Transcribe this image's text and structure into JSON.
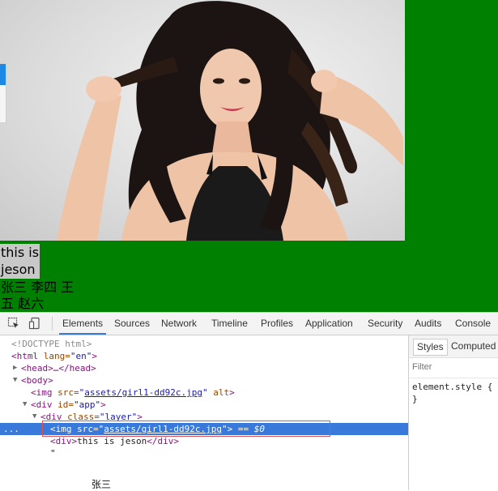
{
  "page": {
    "photo_alt": "woman with long dark hair",
    "caption_line1": "this is",
    "caption_line2": "jeson",
    "names_line1": "张三 李四 王",
    "names_line2": "五 赵六"
  },
  "devtools": {
    "tools": [
      "inspect-icon",
      "device-mode-icon"
    ],
    "tabs": [
      {
        "label": "Elements",
        "active": true
      },
      {
        "label": "Sources"
      },
      {
        "label": "Network"
      },
      {
        "label": "Timeline"
      },
      {
        "label": "Profiles"
      },
      {
        "label": "Application"
      },
      {
        "label": "Security"
      },
      {
        "label": "Audits"
      },
      {
        "label": "Console"
      }
    ],
    "dom": {
      "doctype": "<!DOCTYPE html>",
      "html_open_tag": "<html",
      "html_lang_attr": " lang=",
      "html_lang_val": "\"en\"",
      "html_close": ">",
      "head": "<head>…</head>",
      "body": "<body>",
      "img1_open": "<img",
      "img1_src_attr": " src=",
      "img1_src_q1": "\"",
      "img1_src": "assets/girl1-dd92c.jpg",
      "img1_src_q2": "\"",
      "img1_alt": " alt",
      "img1_close": ">",
      "div_app_open": "<div",
      "div_app_attr": " id=",
      "div_app_val": "\"app\"",
      "div_app_close": ">",
      "div_layer_open": "<div",
      "div_layer_attr": " class=",
      "div_layer_val": "\"layer\"",
      "div_layer_close": ">",
      "sel_dots": "...",
      "img2_open": "<img",
      "img2_src_attr": " src=",
      "img2_src_q1": "\"",
      "img2_src": "assets/girl1-dd92c.jpg",
      "img2_src_q2": "\"",
      "img2_close": ">",
      "img2_eq": " == $0",
      "div_text_open": "<div>",
      "div_text": "this is jeson",
      "div_text_close": "</div>",
      "quote": "\""
    },
    "styles": {
      "tabs": [
        {
          "label": "Styles",
          "active": true
        },
        {
          "label": "Computed"
        }
      ],
      "filter_placeholder": "Filter",
      "rule_selector": "element.style {",
      "rule_close": "}"
    }
  },
  "stray_text": "张三",
  "colors": {
    "page_background": "#008000",
    "selection": "#3879d9",
    "highlight_border": "#e05050"
  }
}
